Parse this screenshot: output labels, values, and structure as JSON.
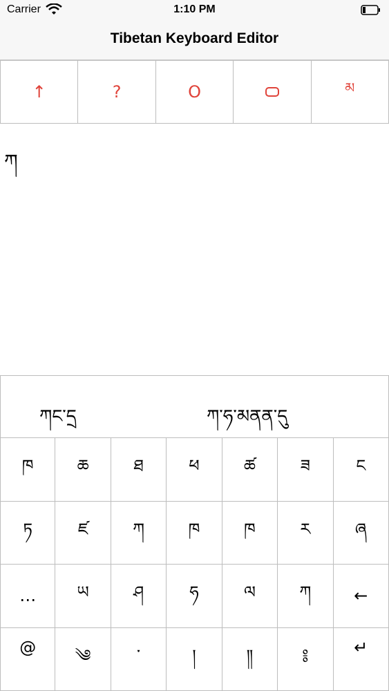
{
  "status": {
    "carrier": "Carrier",
    "time": "1:10 PM"
  },
  "nav": {
    "title": "Tibetan Keyboard Editor"
  },
  "toolbar": [
    {
      "label": "↑",
      "icon": "up-arrow-icon"
    },
    {
      "label": "?",
      "icon": "question-icon"
    },
    {
      "label": "O",
      "icon": "circle-icon"
    },
    {
      "label": "▭",
      "icon": "rounded-rect-icon"
    },
    {
      "label": "མ",
      "icon": "tibetan-ma-icon"
    }
  ],
  "editor": {
    "text": "ཀ"
  },
  "suggestions": [
    "ཀང་དྲ",
    "ཀ་ཧ་མནན་དུ"
  ],
  "keys": [
    [
      "ཁ",
      "ཆ",
      "ཐ",
      "ཕ",
      "ཚ",
      "ཟ",
      "ང"
    ],
    [
      "ཏ",
      "ཛ",
      "ཀ",
      "ཁ",
      "ཁ",
      "ར",
      "ཞ"
    ],
    [
      "…",
      "ཡ",
      "ཤ",
      "ཧ",
      "ལ",
      "ཀ",
      "←"
    ],
    [
      "@",
      "༄",
      "་",
      "།",
      "༎",
      "༔",
      "↵"
    ]
  ],
  "colors": {
    "accent": "#e0433a",
    "grid": "#bdbdbd",
    "bar": "#f7f7f7"
  }
}
